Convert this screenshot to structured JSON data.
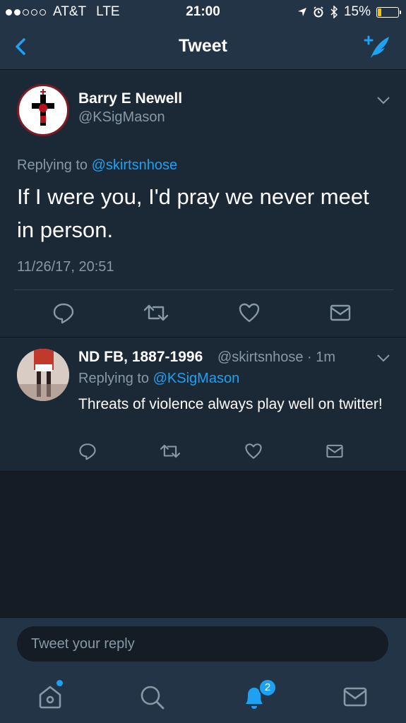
{
  "status": {
    "carrier": "AT&T",
    "network": "LTE",
    "time": "21:00",
    "battery": "15%",
    "battery_color": "#f5c400"
  },
  "nav": {
    "title": "Tweet",
    "back_icon": "chevron-left-icon",
    "compose_icon": "compose-tweet-icon"
  },
  "main_tweet": {
    "name": "Barry E Newell",
    "handle": "@KSigMason",
    "replying_prefix": "Replying to",
    "replying_to": "@skirtsnhose",
    "text": "If I were you, I'd pray we never meet in person.",
    "timestamp": "11/26/17, 20:51"
  },
  "reply_tweet": {
    "name": "ND FB, 1887-1996",
    "handle_time": "@skirtsnhose · 1m",
    "replying_prefix": "Replying to",
    "replying_to": "@KSigMason",
    "text": "Threats of violence always play well on twitter!"
  },
  "composer": {
    "placeholder": "Tweet your reply"
  },
  "tabs": {
    "notifications_badge": "2",
    "items": [
      "home-icon",
      "search-icon",
      "notifications-icon",
      "messages-icon"
    ]
  },
  "colors": {
    "accent": "#1da1f2",
    "background": "#141d26",
    "card": "#1b2836",
    "bar": "#243447",
    "secondary_text": "#8899a6"
  }
}
